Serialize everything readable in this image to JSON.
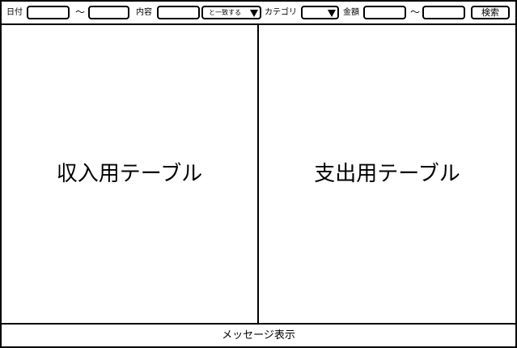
{
  "search_bar": {
    "date_label": "日付",
    "date_from_value": "",
    "date_separator": "～",
    "date_to_value": "",
    "content_label": "内容",
    "content_value": "",
    "match_mode_selected": "と一致する",
    "category_label": "カテゴリ",
    "category_selected": "",
    "amount_label": "金額",
    "amount_from_value": "",
    "amount_separator": "～",
    "amount_to_value": "",
    "search_button_label": "検索"
  },
  "income_table": {
    "label": "収入用テーブル"
  },
  "expense_table": {
    "label": "支出用テーブル"
  },
  "message_area": {
    "label": "メッセージ表示"
  },
  "icons": {
    "dropdown": "caret-down-icon"
  }
}
